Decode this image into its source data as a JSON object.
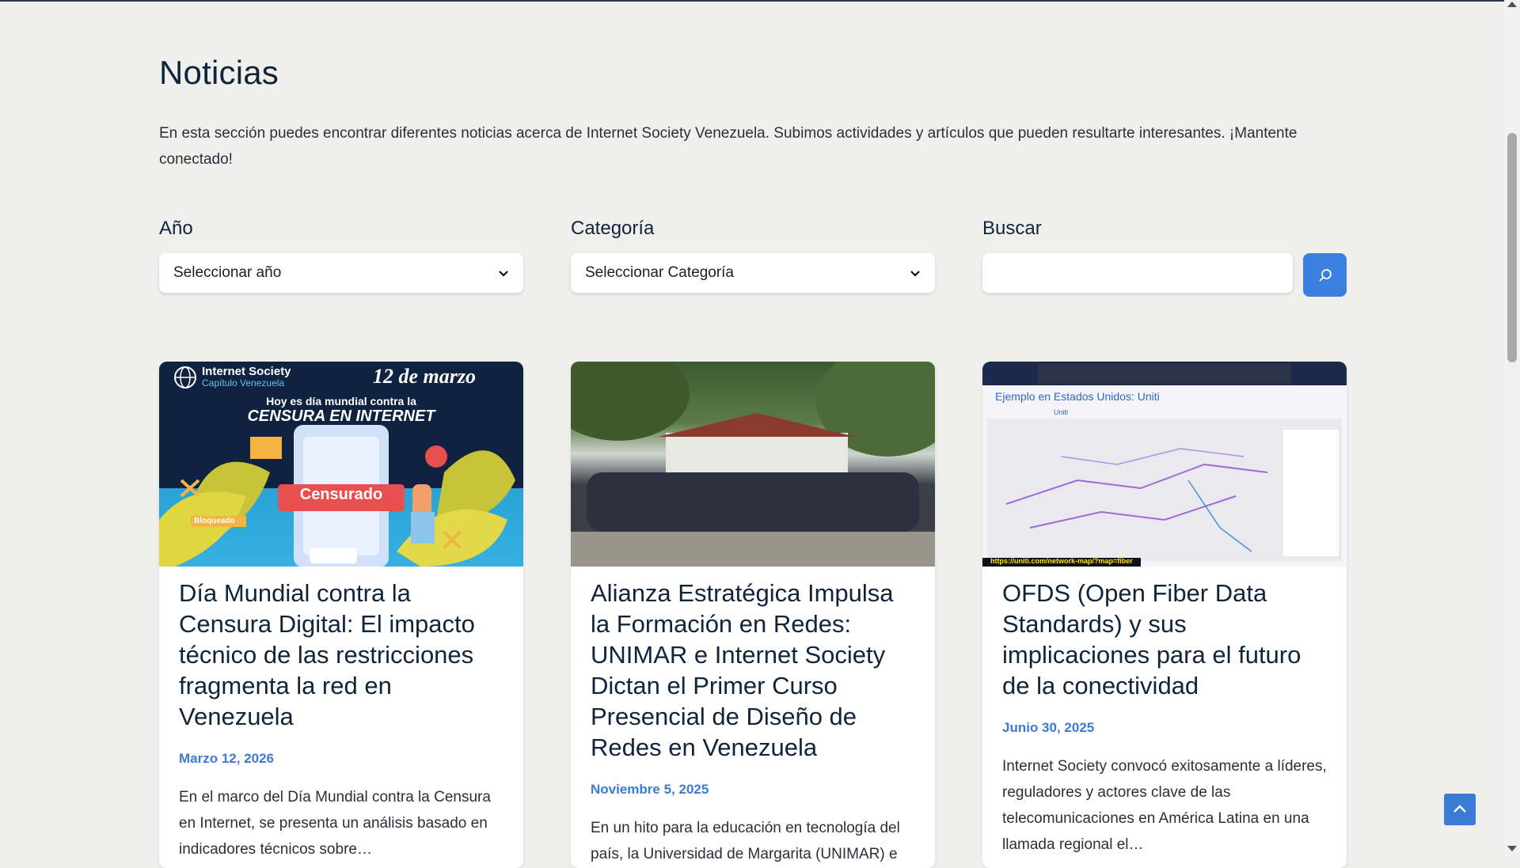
{
  "page": {
    "title": "Noticias",
    "intro": "En esta sección puedes encontrar diferentes noticias acerca de Internet Society Venezuela. Subimos actividades y artículos que pueden resultarte interesantes. ¡Mantente conectado!"
  },
  "filters": {
    "year": {
      "label": "Año",
      "selected": "Seleccionar año"
    },
    "category": {
      "label": "Categoría",
      "selected": "Seleccionar Categoría"
    },
    "search": {
      "label": "Buscar",
      "value": "",
      "icon": "search-icon"
    }
  },
  "colors": {
    "accent": "#3a7bd5",
    "background": "#efefed",
    "heading": "#10243a"
  },
  "cards": [
    {
      "title": "Día Mundial contra la Censura Digital: El impacto técnico de las restricciones fragmenta la red en Venezuela",
      "date": "Marzo 12, 2026",
      "excerpt": "En el marco del Día Mundial contra la Censura en Internet, se presenta un análisis basado en indicadores técnicos sobre…",
      "image": {
        "org": "Internet Society",
        "chapter": "Capítulo Venezuela",
        "date_text": "12 de marzo",
        "line1": "Hoy es día mundial contra la",
        "line2": "CENSURA EN INTERNET",
        "stamp": "Censurado",
        "tag": "Bloqueado"
      }
    },
    {
      "title": "Alianza Estratégica Impulsa la Formación en Redes: UNIMAR e Internet Society Dictan el Primer Curso Presencial de Diseño de Redes en Venezuela",
      "date": "Noviembre 5, 2025",
      "excerpt": "En un hito para la educación en tecnología del país, la Universidad de Margarita (UNIMAR) e Internet Society (ISOC) Capítulo"
    },
    {
      "title": "OFDS (Open Fiber Data Standards) y sus implicaciones para el futuro de la conectividad",
      "date": "Junio 30, 2025",
      "excerpt": "Internet Society convocó exitosamente a líderes, reguladores y actores clave de las telecomunicaciones en América Latina en una llamada regional el…",
      "image": {
        "heading": "Ejemplo en Estados Unidos: Uniti",
        "brand": "Uniti",
        "url": "https://uniti.com/network-map/?map=fiber"
      }
    }
  ],
  "back_to_top": {
    "icon": "chevron-up-icon"
  }
}
